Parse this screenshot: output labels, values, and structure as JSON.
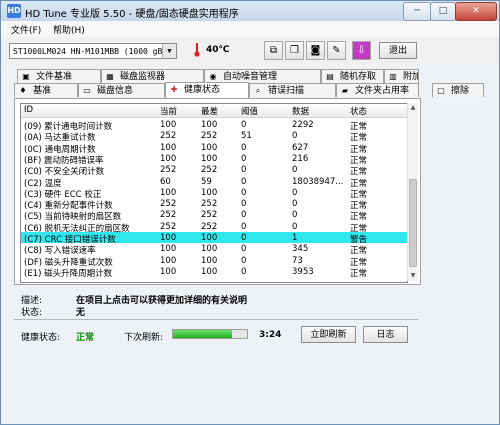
{
  "window": {
    "title": "HD Tune 专业版 5.50 - 硬盘/固态硬盘实用程序",
    "minimize": "─",
    "maximize": "□",
    "close": "✕"
  },
  "menu": [
    "文件(F)",
    "帮助(H)"
  ],
  "toolbar": {
    "drive": "ST1000LM024 HN-M101MBB (1000 gB)",
    "temperature": "40℃",
    "exit_label": "退出"
  },
  "tabs_top": [
    {
      "label": "文件基准",
      "icon": "file-benchmark-icon"
    },
    {
      "label": "磁盘监视器",
      "icon": "disk-monitor-icon"
    },
    {
      "label": "自动噪音管理",
      "icon": "noise-management-icon"
    },
    {
      "label": "随机存取",
      "icon": "random-access-icon"
    },
    {
      "label": "附加测试",
      "icon": "extra-tests-icon"
    }
  ],
  "tabs_bottom": [
    {
      "label": "基准",
      "icon": "benchmark-icon"
    },
    {
      "label": "磁盘信息",
      "icon": "disk-info-icon"
    },
    {
      "label": "健康状态",
      "icon": "health-icon",
      "active": true
    },
    {
      "label": "错误扫描",
      "icon": "error-scan-icon"
    },
    {
      "label": "文件夹占用率",
      "icon": "folder-usage-icon"
    },
    {
      "label": "擦除",
      "icon": "erase-icon"
    }
  ],
  "table": {
    "headers": [
      "ID",
      "当前",
      "最差",
      "阈值",
      "数据",
      "状态"
    ],
    "rows": [
      [
        "(09) 累计通电时间计数",
        "100",
        "100",
        "0",
        "2292",
        "正常"
      ],
      [
        "(0A) 马达重试计数",
        "252",
        "252",
        "51",
        "0",
        "正常"
      ],
      [
        "(0C) 通电周期计数",
        "100",
        "100",
        "0",
        "627",
        "正常"
      ],
      [
        "(BF) 震动防碍错误率",
        "100",
        "100",
        "0",
        "216",
        "正常"
      ],
      [
        "(C0) 不安全关闭计数",
        "252",
        "252",
        "0",
        "0",
        "正常"
      ],
      [
        "(C2) 温度",
        "60",
        "59",
        "0",
        "18038947...",
        "正常"
      ],
      [
        "(C3) 硬件 ECC 校正",
        "100",
        "100",
        "0",
        "0",
        "正常"
      ],
      [
        "(C4) 重新分配事件计数",
        "252",
        "252",
        "0",
        "0",
        "正常"
      ],
      [
        "(C5) 当前待映射的扇区数",
        "252",
        "252",
        "0",
        "0",
        "正常"
      ],
      [
        "(C6) 脱机无法纠正的扇区数",
        "252",
        "252",
        "0",
        "0",
        "正常"
      ],
      [
        "(C7) CRC 接口错误计数",
        "100",
        "100",
        "0",
        "1",
        "警告"
      ],
      [
        "(C8) 写入错误速率",
        "100",
        "100",
        "0",
        "345",
        "正常"
      ],
      [
        "(DF) 磁头升降重试次数",
        "100",
        "100",
        "0",
        "73",
        "正常"
      ],
      [
        "(E1) 磁头升降周期计数",
        "100",
        "100",
        "0",
        "3953",
        "正常"
      ]
    ],
    "highlighted_row": 10,
    "highlight_color": "#2fe8ee"
  },
  "info": {
    "description_label": "描述:",
    "description_value": "在项目上点击可以获得更加详细的有关说明",
    "status_label": "状态:",
    "status_value": "无"
  },
  "footer": {
    "health_label": "健康状态:",
    "health_value": "正常",
    "health_color": "#0a8a0a",
    "next_refresh_label": "下次刷新:",
    "next_refresh_time": "3:24",
    "refresh_progress": 0.8,
    "refresh_now_label": "立即刷新",
    "log_label": "日志"
  }
}
